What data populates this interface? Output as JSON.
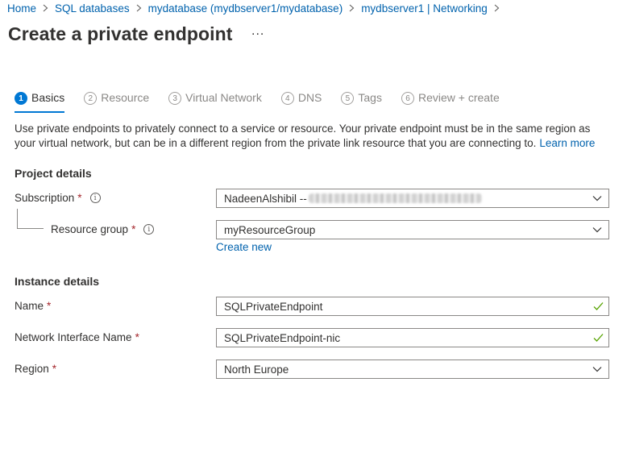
{
  "breadcrumb": [
    "Home",
    "SQL databases",
    "mydatabase (mydbserver1/mydatabase)",
    "mydbserver1 | Networking"
  ],
  "page": {
    "title": "Create a private endpoint",
    "more": "..."
  },
  "tabs": [
    {
      "num": "1",
      "label": "Basics",
      "active": true
    },
    {
      "num": "2",
      "label": "Resource"
    },
    {
      "num": "3",
      "label": "Virtual Network"
    },
    {
      "num": "4",
      "label": "DNS"
    },
    {
      "num": "5",
      "label": "Tags"
    },
    {
      "num": "6",
      "label": "Review + create"
    }
  ],
  "description": {
    "text": "Use private endpoints to privately connect to a service or resource. Your private endpoint must be in the same region as your virtual network, but can be in a different region from the private link resource that you are connecting to.",
    "learn_more": "Learn more"
  },
  "project": {
    "heading": "Project details",
    "subscription": {
      "label": "Subscription",
      "required": "*",
      "value": "NadeenAlshibil --"
    },
    "resource_group": {
      "label": "Resource group",
      "required": "*",
      "value": "myResourceGroup",
      "create_new": "Create new"
    }
  },
  "instance": {
    "heading": "Instance details",
    "name": {
      "label": "Name",
      "required": "*",
      "value": "SQLPrivateEndpoint"
    },
    "nic": {
      "label": "Network Interface Name",
      "required": "*",
      "value": "SQLPrivateEndpoint-nic"
    },
    "region": {
      "label": "Region",
      "required": "*",
      "value": "North Europe"
    }
  },
  "colors": {
    "link": "#0062ad",
    "accent": "#0078d4",
    "required": "#a4262c",
    "valid": "#57a300"
  },
  "icons": {
    "info": "info-icon",
    "dropdown": "chevron-down-icon",
    "valid": "checkmark-icon",
    "separator": "chevron-right-icon"
  }
}
